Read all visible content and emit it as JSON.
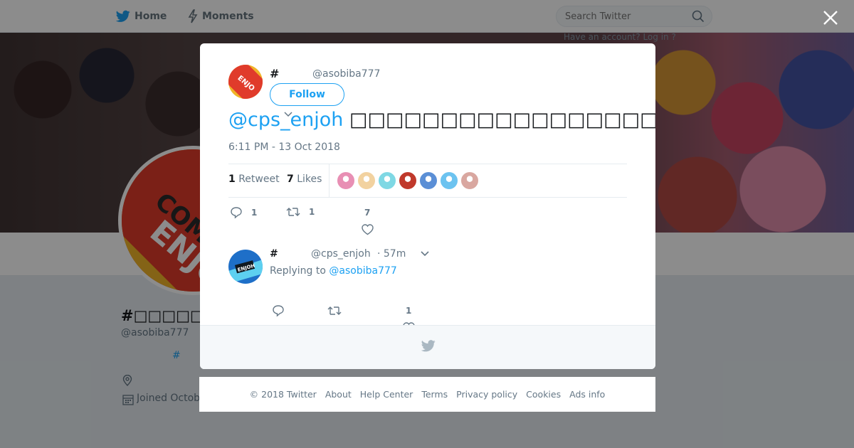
{
  "topbar": {
    "home_label": "Home",
    "moments_label": "Moments",
    "search_placeholder": "Search Twitter"
  },
  "profile": {
    "account_hint": "Have an account? Log in ?",
    "name": "#□□□□□□□□",
    "handle": "@asobiba777",
    "hashtag": "#",
    "joined": "Joined October"
  },
  "tweet": {
    "author_name": "#",
    "author_handle": "@asobiba777",
    "follow_label": "Follow",
    "mention": "@cps_enjoh",
    "body": "□□□□□□□□□□□□□□□□□□□□□□□□□□□□□□□□□□□□□□□□□□□□□□□□□□□□□□□□□□",
    "timestamp": "6:11 PM - 13 Oct 2018",
    "retweet_count": "1",
    "retweet_label": "Retweet",
    "like_count": "7",
    "like_label": "Likes",
    "reply_action_count": "1",
    "retweet_action_count": "1",
    "like_action_count": "7",
    "liker_colors": [
      "#e88fb4",
      "#f2d2a0",
      "#7fd8e4",
      "#c0392b",
      "#5b8fd6",
      "#6cc3f0",
      "#d9a7a0"
    ]
  },
  "reply": {
    "author_name": "#",
    "author_handle": "@cps_enjoh",
    "time": "· 57m",
    "replying_prefix": "Replying to",
    "replying_to": "@asobiba777",
    "like_count": "1"
  },
  "footer": {
    "links": [
      "© 2018 Twitter",
      "About",
      "Help Center",
      "Terms",
      "Privacy policy",
      "Cookies",
      "Ads info"
    ]
  },
  "colors": {
    "brand": "#1da1f2",
    "muted": "#657786",
    "overlay": "rgba(0,0,0,0.45)"
  }
}
